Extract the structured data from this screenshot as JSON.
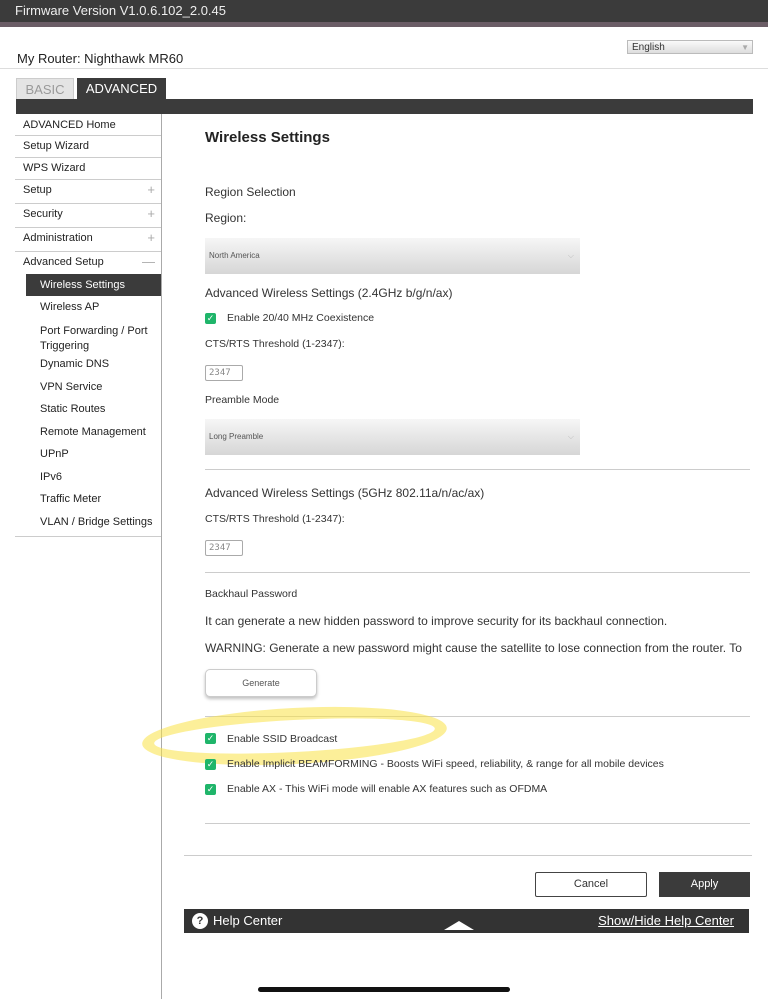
{
  "firmware": "Firmware Version V1.0.6.102_2.0.45",
  "router_label": "My Router: Nighthawk MR60",
  "language": "English",
  "tabs": {
    "basic": "BASIC",
    "advanced": "ADVANCED"
  },
  "sidebar": {
    "items": [
      {
        "label": "ADVANCED Home",
        "expand": ""
      },
      {
        "label": "Setup Wizard",
        "expand": ""
      },
      {
        "label": "WPS Wizard",
        "expand": ""
      },
      {
        "label": "Setup",
        "expand": "+"
      },
      {
        "label": "Security",
        "expand": "+"
      },
      {
        "label": "Administration",
        "expand": "+"
      },
      {
        "label": "Advanced Setup",
        "expand": "—"
      }
    ],
    "subitems": [
      "Wireless Settings",
      "Wireless AP",
      "Port Forwarding / Port Triggering",
      "Dynamic DNS",
      "VPN Service",
      "Static Routes",
      "Remote Management",
      "UPnP",
      "IPv6",
      "Traffic Meter",
      "VLAN / Bridge Settings"
    ]
  },
  "main": {
    "title": "Wireless Settings",
    "region_selection": "Region Selection",
    "region_label": "Region:",
    "region_value": "North America",
    "adv_24_title": "Advanced Wireless Settings (2.4GHz b/g/n/ax)",
    "coexistence_label": "Enable 20/40 MHz Coexistence",
    "cts_label_24": "CTS/RTS Threshold (1-2347):",
    "cts_value_24": "2347",
    "preamble_label": "Preamble Mode",
    "preamble_value": "Long Preamble",
    "adv_5_title": "Advanced Wireless Settings (5GHz 802.11a/n/ac/ax)",
    "cts_label_5": "CTS/RTS Threshold (1-2347):",
    "cts_value_5": "2347",
    "backhaul_title": "Backhaul Password",
    "backhaul_desc": "It can generate a new hidden password to improve security for its backhaul connection.",
    "backhaul_warning": "WARNING: Generate a new password might cause the satellite to lose connection from the router. To",
    "generate_label": "Generate",
    "ssid_broadcast_label": "Enable SSID Broadcast",
    "beamforming_label": "Enable Implicit BEAMFORMING - Boosts WiFi speed, reliability, & range for all mobile devices",
    "ax_label": "Enable AX - This WiFi mode will enable AX features such as OFDMA"
  },
  "actions": {
    "cancel": "Cancel",
    "apply": "Apply"
  },
  "help": {
    "icon": "?",
    "label": "Help Center",
    "toggle": "Show/Hide Help Center"
  },
  "colors": {
    "dark": "#3b3b3b",
    "checkbox": "#1fb56a",
    "highlight": "#fae146"
  }
}
